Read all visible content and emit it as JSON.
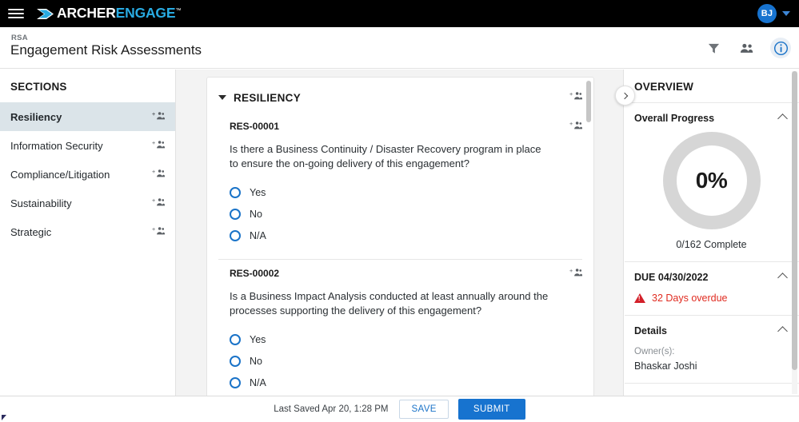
{
  "topbar": {
    "menu_icon": "hamburger-menu-icon",
    "logo_archer": "ARCHER",
    "logo_engage": "ENGAGE",
    "logo_tm": "™",
    "avatar_initials": "BJ"
  },
  "header": {
    "eyebrow": "RSA",
    "title": "Engagement Risk Assessments",
    "icons": [
      {
        "name": "filter-icon",
        "label": "Filter"
      },
      {
        "name": "people-icon",
        "label": "Participants"
      },
      {
        "name": "info-icon",
        "label": "Information"
      }
    ]
  },
  "sidebar": {
    "heading": "SECTIONS",
    "items": [
      {
        "label": "Resiliency",
        "selected": true
      },
      {
        "label": "Information Security",
        "selected": false
      },
      {
        "label": "Compliance/Litigation",
        "selected": false
      },
      {
        "label": "Sustainability",
        "selected": false
      },
      {
        "label": "Strategic",
        "selected": false
      }
    ]
  },
  "main": {
    "section_title": "RESILIENCY",
    "questions": [
      {
        "id": "RES-00001",
        "text": "Is there a Business Continuity / Disaster Recovery program in place to ensure the on-going delivery of this engagement?",
        "options": [
          "Yes",
          "No",
          "N/A"
        ]
      },
      {
        "id": "RES-00002",
        "text": "Is a Business Impact Analysis conducted at least annually around the processes supporting the delivery of this engagement?",
        "options": [
          "Yes",
          "No",
          "N/A"
        ]
      }
    ]
  },
  "overview": {
    "heading": "OVERVIEW",
    "progress": {
      "title": "Overall Progress",
      "percent_label": "0%",
      "percent_value": 0,
      "complete_label": "0/162 Complete",
      "completed_count": 0,
      "total_count": 162
    },
    "due": {
      "title": "DUE 04/30/2022",
      "overdue_label": "32 Days overdue",
      "overdue_color": "#e02b20"
    },
    "details": {
      "title": "Details",
      "owner_label": "Owner(s):",
      "owner_value": "Bhaskar Joshi"
    }
  },
  "bottombar": {
    "last_saved": "Last Saved Apr 20, 1:28 PM",
    "save_label": "SAVE",
    "submit_label": "SUBMIT"
  },
  "colors": {
    "brand_blue": "#1773cf",
    "logo_blue": "#29abe2",
    "selected_bg": "#dbe4e9",
    "danger": "#e02b20"
  }
}
